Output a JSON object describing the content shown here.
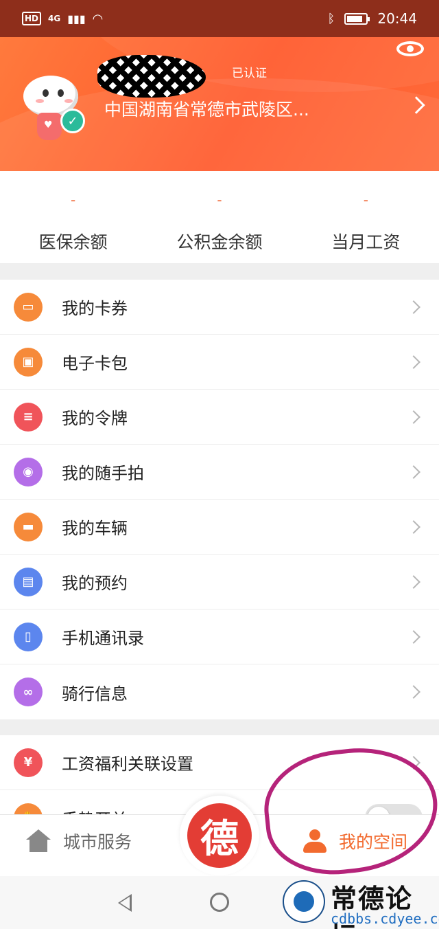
{
  "status_bar": {
    "left": "HD",
    "network": "4G",
    "time": "20:44",
    "battery_level": 0.85
  },
  "profile": {
    "verified_label": "已认证",
    "address": "中国湖南省常德市武陵区..."
  },
  "balances": [
    {
      "label": "医保余额",
      "value": "-"
    },
    {
      "label": "公积金余额",
      "value": "-"
    },
    {
      "label": "当月工资",
      "value": "-"
    }
  ],
  "menu_main": [
    {
      "label": "我的卡券",
      "icon": "card-icon",
      "color": "#f68a3a"
    },
    {
      "label": "电子卡包",
      "icon": "wallet-icon",
      "color": "#f68a3a"
    },
    {
      "label": "我的令牌",
      "icon": "token-icon",
      "color": "#f0545a"
    },
    {
      "label": "我的随手拍",
      "icon": "camera-icon",
      "color": "#b46ee8"
    },
    {
      "label": "我的车辆",
      "icon": "car-icon",
      "color": "#f68a3a"
    },
    {
      "label": "我的预约",
      "icon": "document-icon",
      "color": "#5c86ee"
    },
    {
      "label": "手机通讯录",
      "icon": "contacts-icon",
      "color": "#5c86ee"
    },
    {
      "label": "骑行信息",
      "icon": "bike-icon",
      "color": "#b46ee8"
    }
  ],
  "menu_secondary": [
    {
      "label": "工资福利关联设置",
      "icon": "money-bag-icon",
      "color": "#f0545a"
    },
    {
      "label": "手势开关",
      "icon": "gesture-icon",
      "color": "#f68a3a"
    }
  ],
  "bottom_nav": {
    "left_label": "城市服务",
    "center_label": "德",
    "right_label": "我的空间"
  },
  "watermark": {
    "title": "常德论坛",
    "url": "cdbbs.cdyee.com"
  },
  "colors": {
    "accent": "#f26a2e",
    "header": "#ff6a35",
    "annotation": "#b5237a"
  }
}
